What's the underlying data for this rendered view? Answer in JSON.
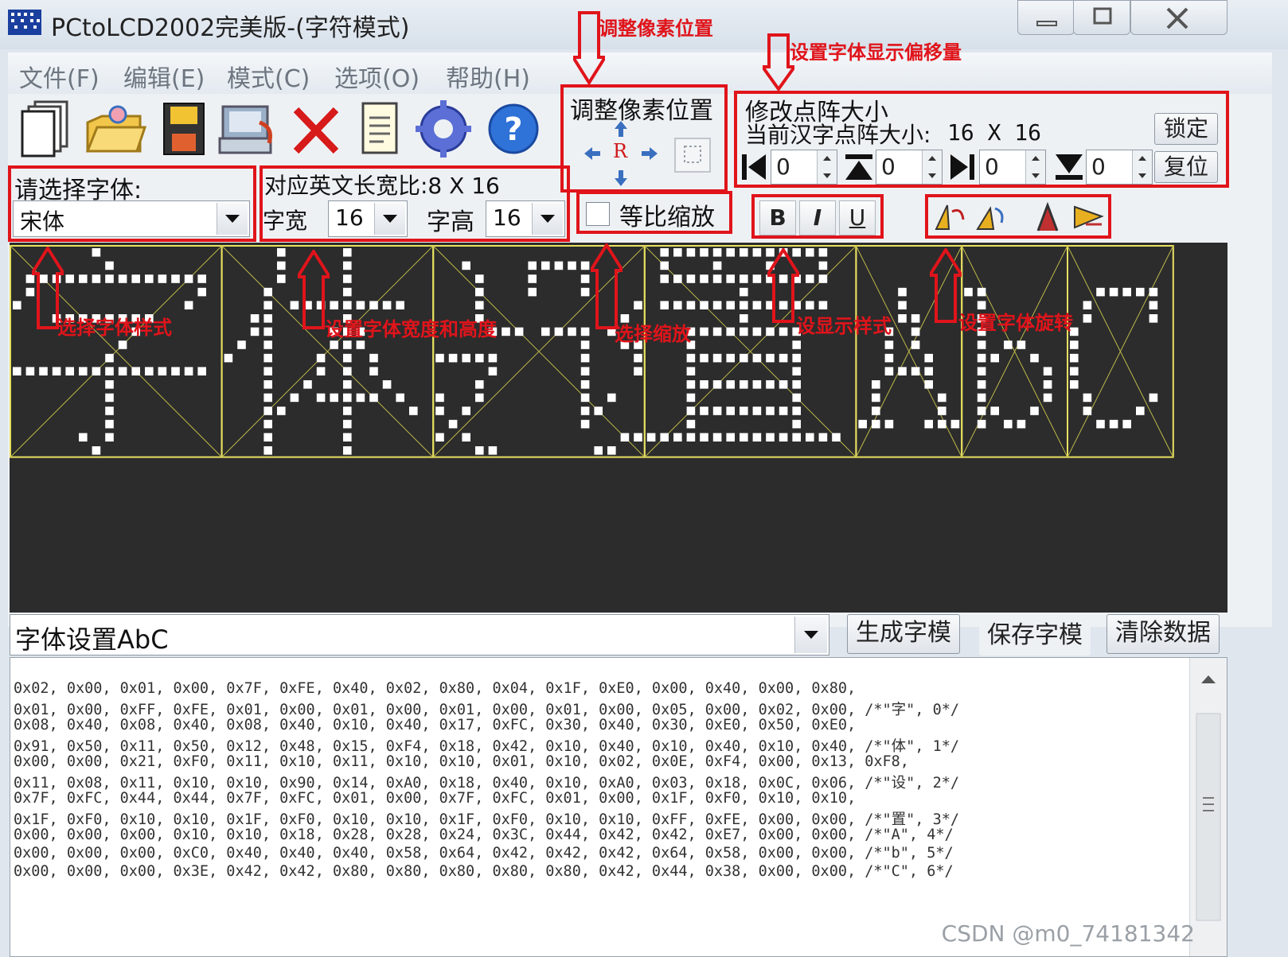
{
  "window": {
    "title": "PCtoLCD2002完美版-(字符模式)"
  },
  "menu": [
    "文件(F)",
    "编辑(E)",
    "模式(C)",
    "选项(O)",
    "帮助(H)"
  ],
  "toolbar_icons": [
    "new-file-icon",
    "open-folder-icon",
    "save-disk-icon",
    "import-icon",
    "delete-icon",
    "notepad-icon",
    "settings-gear-icon",
    "help-icon"
  ],
  "pixel_adjust": {
    "title": "调整像素位置",
    "center_label": "R"
  },
  "font_panel": {
    "label": "请选择字体:",
    "font_value": "宋体"
  },
  "size_panel": {
    "ratio_label": "对应英文长宽比:8 X 16",
    "width_label": "字宽",
    "width_value": "16",
    "height_label": "字高",
    "height_value": "16"
  },
  "scale": {
    "label": "等比缩放",
    "checked": false
  },
  "matrix_panel": {
    "title": "修改点阵大小",
    "current_label": "当前汉字点阵大小:",
    "current_value": "16 X 16",
    "lock_button": "锁定",
    "reset_button": "复位",
    "offsets": [
      "0",
      "0",
      "0",
      "0"
    ]
  },
  "format_buttons": [
    "B",
    "I",
    "U"
  ],
  "annotations": {
    "adjust_pixel": "调整像素位置",
    "offset": "设置字体显示偏移量",
    "font_style": "选择字体样式",
    "size": "设置字体宽度和高度",
    "scale": "选择缩放",
    "display_style": "设显示样式",
    "rotation": "设置字体旋转"
  },
  "input": {
    "text": "字体设置AbC"
  },
  "actions": {
    "generate": "生成字模",
    "save": "保存字模",
    "clear": "清除数据"
  },
  "output_lines": [
    "0x02, 0x00, 0x01, 0x00, 0x7F, 0xFE, 0x40, 0x02, 0x80, 0x04, 0x1F, 0xE0, 0x00, 0x40, 0x00, 0x80,",
    "0x01, 0x00, 0xFF, 0xFE, 0x01, 0x00, 0x01, 0x00, 0x01, 0x00, 0x01, 0x00, 0x05, 0x00, 0x02, 0x00, /*\"字\", 0*/",
    "0x08, 0x40, 0x08, 0x40, 0x08, 0x40, 0x10, 0x40, 0x17, 0xFC, 0x30, 0x40, 0x30, 0xE0, 0x50, 0xE0,",
    "0x91, 0x50, 0x11, 0x50, 0x12, 0x48, 0x15, 0xF4, 0x18, 0x42, 0x10, 0x40, 0x10, 0x40, 0x10, 0x40, /*\"体\", 1*/",
    "0x00, 0x00, 0x21, 0xF0, 0x11, 0x10, 0x11, 0x10, 0x10, 0x01, 0x10, 0x02, 0x0E, 0xF4, 0x00, 0x13, 0xF8,",
    "0x11, 0x08, 0x11, 0x10, 0x10, 0x90, 0x14, 0xA0, 0x18, 0x40, 0x10, 0xA0, 0x03, 0x18, 0x0C, 0x06, /*\"设\", 2*/",
    "0x7F, 0xFC, 0x44, 0x44, 0x7F, 0xFC, 0x01, 0x00, 0x7F, 0xFC, 0x01, 0x00, 0x1F, 0xF0, 0x10, 0x10,",
    "0x1F, 0xF0, 0x10, 0x10, 0x1F, 0xF0, 0x10, 0x10, 0x1F, 0xF0, 0x10, 0x10, 0xFF, 0xFE, 0x00, 0x00, /*\"置\", 3*/",
    "0x00, 0x00, 0x00, 0x10, 0x10, 0x18, 0x28, 0x28, 0x24, 0x3C, 0x44, 0x42, 0x42, 0xE7, 0x00, 0x00, /*\"A\", 4*/",
    "0x00, 0x00, 0x00, 0xC0, 0x40, 0x40, 0x40, 0x58, 0x64, 0x42, 0x42, 0x42, 0x64, 0x58, 0x00, 0x00, /*\"b\", 5*/",
    "0x00, 0x00, 0x00, 0x3E, 0x42, 0x42, 0x80, 0x80, 0x80, 0x80, 0x80, 0x42, 0x44, 0x38, 0x00, 0x00, /*\"C\", 6*/"
  ],
  "watermark": "CSDN @m0_74181342"
}
